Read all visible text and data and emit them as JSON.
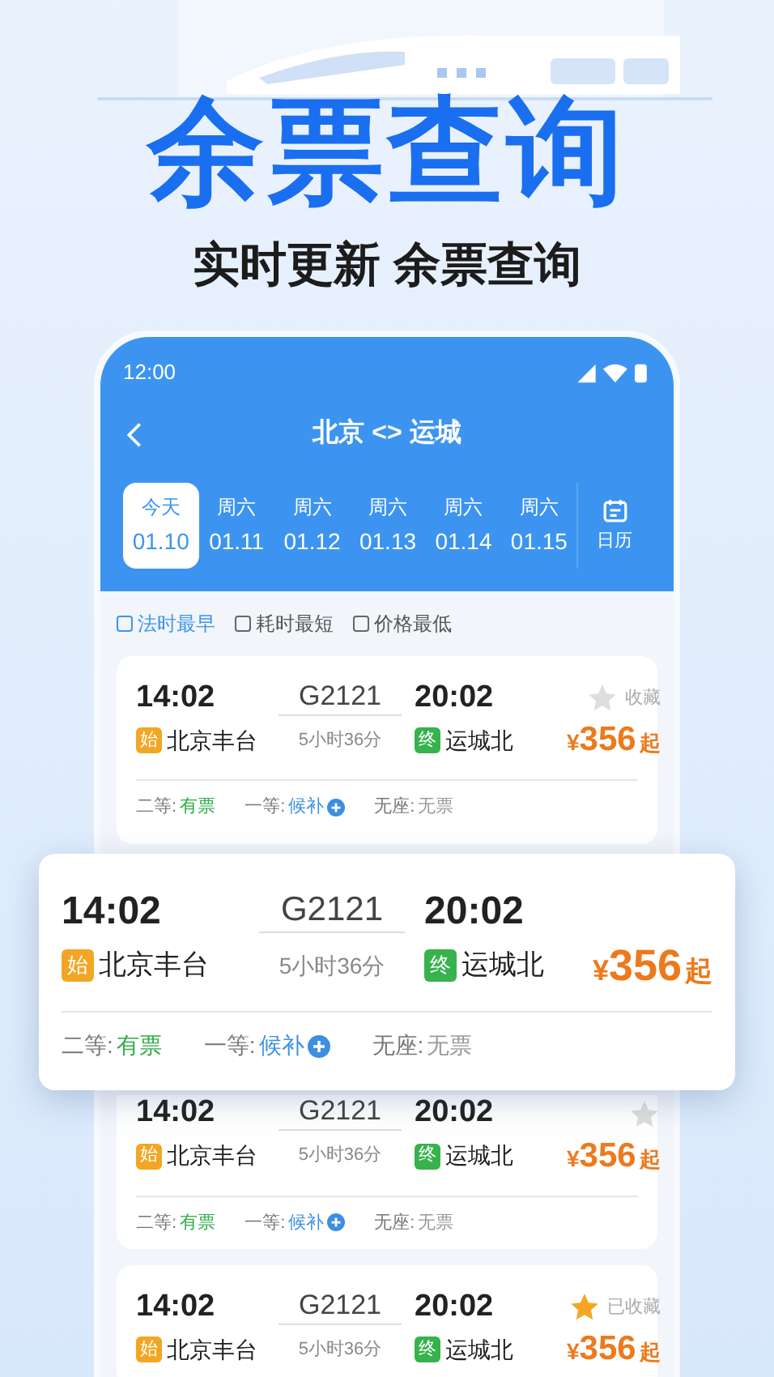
{
  "headline": "余票查询",
  "subtitle": "实时更新 余票查询",
  "phone": {
    "status_time": "12:00",
    "title": "北京 <> 运城",
    "dates": [
      {
        "weekday": "今天",
        "date": "01.10",
        "selected": true
      },
      {
        "weekday": "周六",
        "date": "01.11",
        "selected": false
      },
      {
        "weekday": "周六",
        "date": "01.12",
        "selected": false
      },
      {
        "weekday": "周六",
        "date": "01.13",
        "selected": false
      },
      {
        "weekday": "周六",
        "date": "01.14",
        "selected": false
      },
      {
        "weekday": "周六",
        "date": "01.15",
        "selected": false
      }
    ],
    "calendar_label": "日历",
    "filters": [
      {
        "label": "法时最早",
        "selected": true
      },
      {
        "label": "耗时最短",
        "selected": false
      },
      {
        "label": "价格最低",
        "selected": false
      }
    ],
    "trains": [
      {
        "depart_time": "14:02",
        "train_no": "G2121",
        "arrive_time": "20:02",
        "from_badge": "始",
        "from_station": "北京丰台",
        "duration": "5小时36分",
        "to_badge": "终",
        "to_station": "运城北",
        "price_symbol": "¥",
        "price": "356",
        "price_suffix": "起",
        "favorited": false,
        "favorite_label": "收藏",
        "seats": [
          {
            "class": "二等:",
            "text": "有票",
            "kind": "available"
          },
          {
            "class": "一等:",
            "text": "候补",
            "kind": "waitlist"
          },
          {
            "class": "无座:",
            "text": "无票",
            "kind": "none"
          }
        ]
      },
      {
        "depart_time": "14:02",
        "train_no": "G2121",
        "arrive_time": "20:02",
        "from_badge": "始",
        "from_station": "北京丰台",
        "duration": "5小时36分",
        "to_badge": "终",
        "to_station": "运城北",
        "price_symbol": "¥",
        "price": "356",
        "price_suffix": "起",
        "favorited": false,
        "seats": [
          {
            "class": "二等:",
            "text": "有票",
            "kind": "available"
          },
          {
            "class": "一等:",
            "text": "候补",
            "kind": "waitlist"
          },
          {
            "class": "无座:",
            "text": "无票",
            "kind": "none"
          }
        ]
      },
      {
        "depart_time": "14:02",
        "train_no": "G2121",
        "arrive_time": "20:02",
        "from_badge": "始",
        "from_station": "北京丰台",
        "duration": "5小时36分",
        "to_badge": "终",
        "to_station": "运城北",
        "price_symbol": "¥",
        "price": "356",
        "price_suffix": "起",
        "favorited": true,
        "favorite_label": "已收藏"
      }
    ]
  },
  "highlight_card": {
    "depart_time": "14:02",
    "train_no": "G2121",
    "arrive_time": "20:02",
    "from_badge": "始",
    "from_station": "北京丰台",
    "duration": "5小时36分",
    "to_badge": "终",
    "to_station": "运城北",
    "price_symbol": "¥",
    "price": "356",
    "price_suffix": "起",
    "seats": [
      {
        "class": "二等:",
        "text": "有票",
        "kind": "available"
      },
      {
        "class": "一等:",
        "text": "候补",
        "kind": "waitlist"
      },
      {
        "class": "无座:",
        "text": "无票",
        "kind": "none"
      }
    ]
  }
}
